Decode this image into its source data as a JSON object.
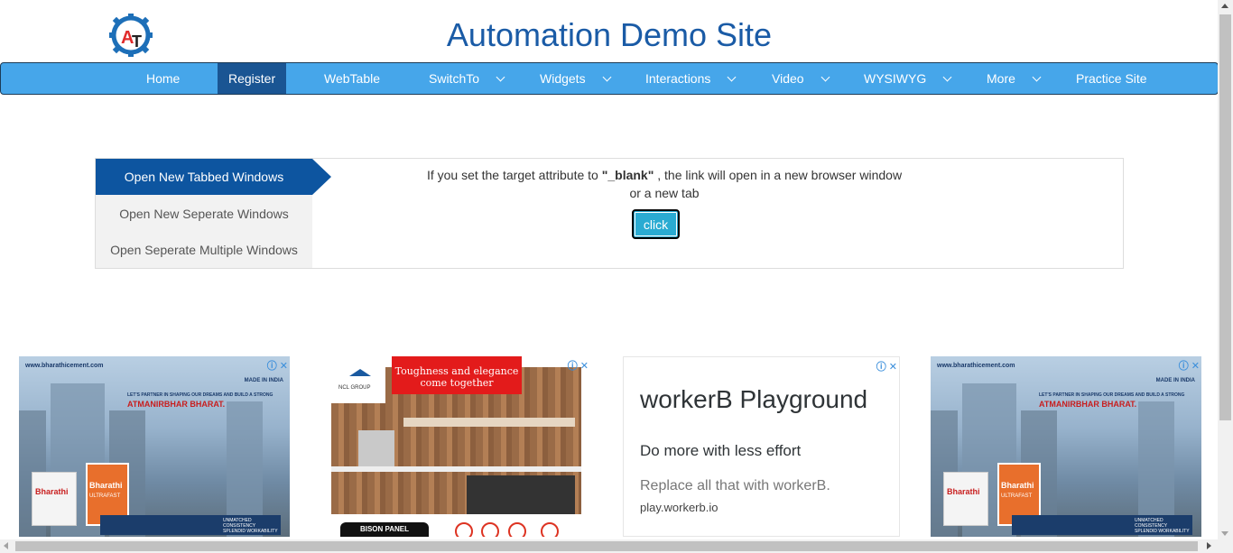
{
  "header": {
    "title": "Automation Demo Site",
    "logo_letters": "AT"
  },
  "nav": {
    "items": [
      {
        "label": "Home",
        "dropdown": false
      },
      {
        "label": "Register",
        "dropdown": false,
        "active": true
      },
      {
        "label": "WebTable",
        "dropdown": false
      },
      {
        "label": "SwitchTo",
        "dropdown": true
      },
      {
        "label": "Widgets",
        "dropdown": true
      },
      {
        "label": "Interactions",
        "dropdown": true
      },
      {
        "label": "Video",
        "dropdown": true
      },
      {
        "label": "WYSIWYG",
        "dropdown": true
      },
      {
        "label": "More",
        "dropdown": true
      },
      {
        "label": "Practice Site",
        "dropdown": false
      }
    ]
  },
  "windows": {
    "tabs": [
      {
        "label": "Open New Tabbed Windows",
        "active": true
      },
      {
        "label": "Open New Seperate Windows",
        "active": false
      },
      {
        "label": "Open Seperate Multiple Windows",
        "active": false
      }
    ],
    "text_before": "If you set the target attribute to ",
    "text_bold": "\"_blank\"",
    "text_after": " , the link will open in a new browser window",
    "text_line2": "or a new tab",
    "button_label": "click"
  },
  "ads": {
    "bharathi": {
      "url": "www.bharathicement.com",
      "tagline": "LET'S PARTNER IN SHAPING OUR DREAMS AND BUILD A STRONG",
      "banner": "ATMANIRBHAR BHARAT.",
      "made_in": "MADE IN INDIA",
      "bag_brand": "Bharathi",
      "bag_sub": "ULTRAFAST",
      "foot": "UNMATCHED CONSISTENCY SPLENDID WORKABILITY"
    },
    "ncl": {
      "logo": "NCL GROUP",
      "headline": "Toughness and elegance come together",
      "brand": "BISON PANEL"
    },
    "workerb": {
      "title": "workerB Playground",
      "subtitle": "Do more with less effort",
      "description": "Replace all that with workerB.",
      "url": "play.workerb.io"
    },
    "close_glyph": "ⓘ ✕"
  },
  "colors": {
    "nav_bg": "#46a6ea",
    "nav_active": "#1a5593",
    "title": "#1a5ba6",
    "tab_active": "#0d55a0",
    "button": "#2aabd2"
  }
}
